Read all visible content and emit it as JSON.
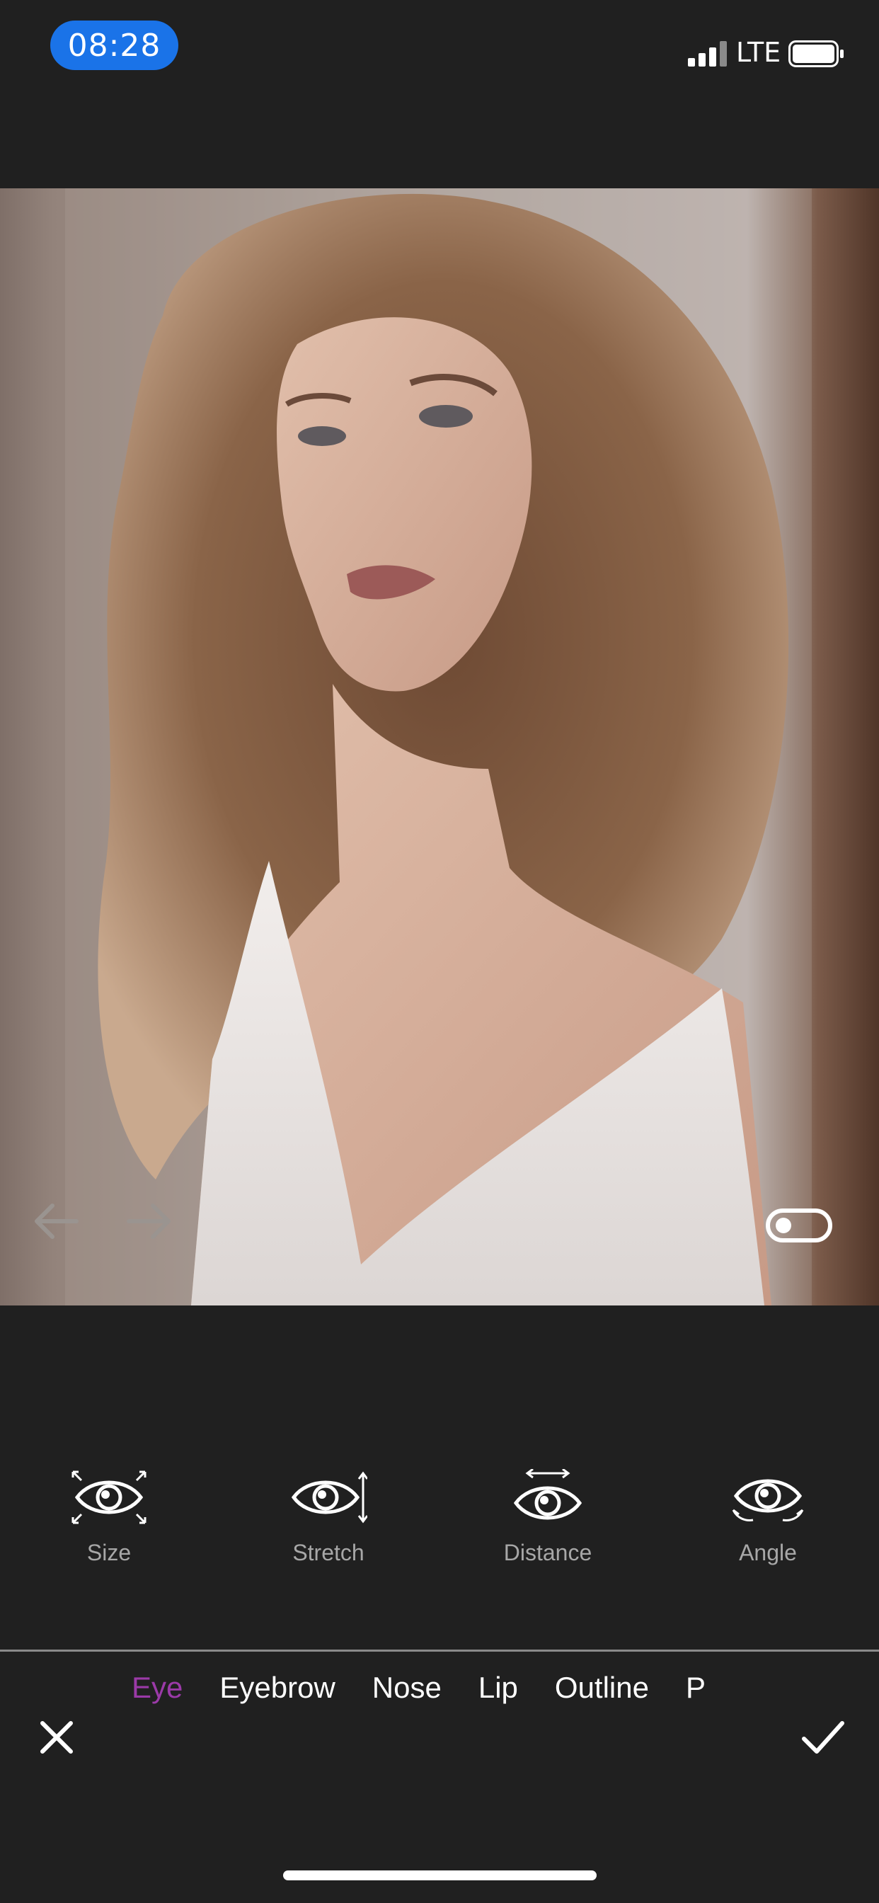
{
  "status_bar": {
    "time": "08:28",
    "network": "LTE"
  },
  "editor": {
    "tools": [
      {
        "label": "Size",
        "icon": "eye-size-icon"
      },
      {
        "label": "Stretch",
        "icon": "eye-stretch-icon"
      },
      {
        "label": "Distance",
        "icon": "eye-distance-icon"
      },
      {
        "label": "Angle",
        "icon": "eye-angle-icon"
      }
    ],
    "categories": [
      {
        "label": "Eye",
        "active": true
      },
      {
        "label": "Eyebrow",
        "active": false
      },
      {
        "label": "Nose",
        "active": false
      },
      {
        "label": "Lip",
        "active": false
      },
      {
        "label": "Outline",
        "active": false
      },
      {
        "label": "P",
        "active": false
      }
    ]
  },
  "colors": {
    "background": "#202020",
    "accent_active_tab": "#9b3aa8",
    "time_pill": "#1a73e8",
    "tool_label": "#a7a7a7"
  }
}
